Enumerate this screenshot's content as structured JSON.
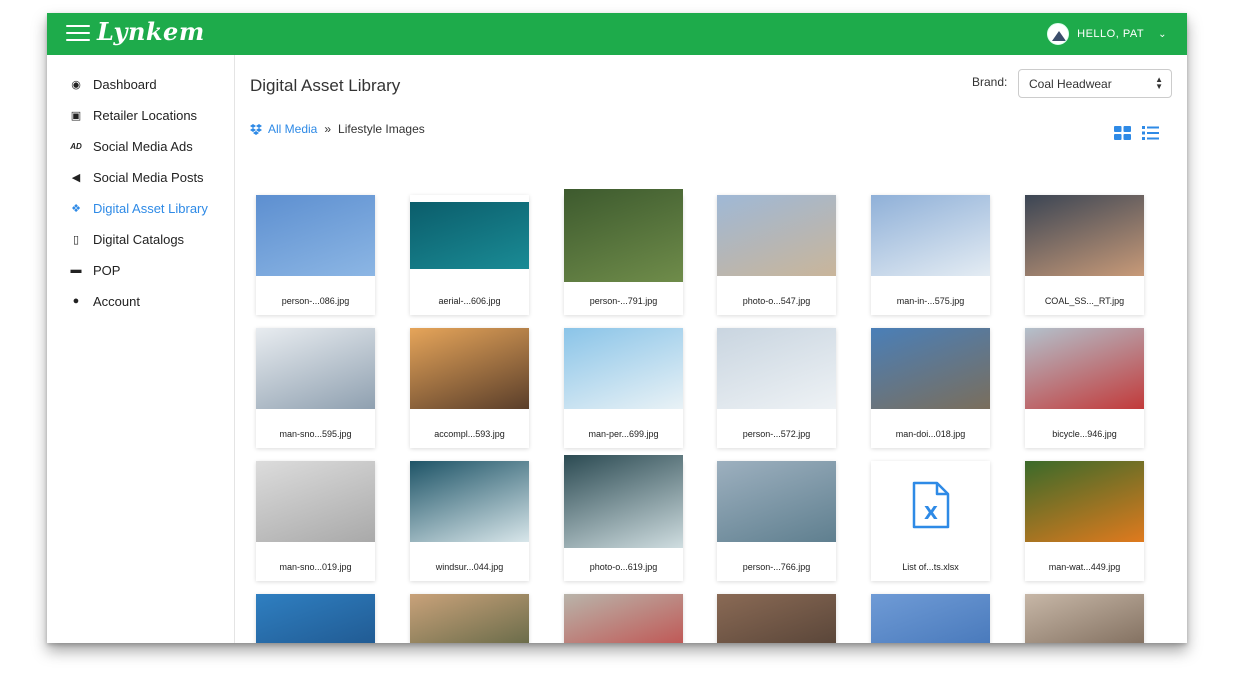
{
  "app": {
    "logo": "Lynkem"
  },
  "header": {
    "greeting": "HELLO, PAT"
  },
  "sidebar": {
    "items": [
      {
        "label": "Dashboard",
        "icon": "dashboard-icon",
        "glyph": "◉"
      },
      {
        "label": "Retailer Locations",
        "icon": "image-icon",
        "glyph": "▣"
      },
      {
        "label": "Social Media Ads",
        "icon": "ads-icon",
        "glyph": "AD"
      },
      {
        "label": "Social Media Posts",
        "icon": "bullhorn-icon",
        "glyph": "◀"
      },
      {
        "label": "Digital Asset Library",
        "icon": "dropbox-icon",
        "glyph": "❖",
        "active": true
      },
      {
        "label": "Digital Catalogs",
        "icon": "pdf-file-icon",
        "glyph": "▯"
      },
      {
        "label": "POP",
        "icon": "cart-icon",
        "glyph": "▬"
      },
      {
        "label": "Account",
        "icon": "user-icon",
        "glyph": "●"
      }
    ]
  },
  "main": {
    "title": "Digital Asset Library",
    "brand_label": "Brand:",
    "brand_value": "Coal Headwear",
    "breadcrumb": {
      "root": "All Media",
      "sep": "»",
      "current": "Lifestyle Images"
    }
  },
  "colors": {
    "header_green": "#1eab4b",
    "accent_blue": "#2e8ae6"
  },
  "assets": [
    {
      "name": "person-...086.jpg",
      "kind": "image",
      "colors": [
        "#5d8fd0",
        "#8cb6e4"
      ]
    },
    {
      "name": "aerial-...606.jpg",
      "kind": "image",
      "colors": [
        "#0b5d6b",
        "#1a8b95"
      ]
    },
    {
      "name": "person-...791.jpg",
      "kind": "image",
      "colors": [
        "#3d5a2e",
        "#6f8c4a"
      ]
    },
    {
      "name": "photo-o...547.jpg",
      "kind": "image",
      "colors": [
        "#9fb8d6",
        "#c9b59a"
      ]
    },
    {
      "name": "man-in-...575.jpg",
      "kind": "image",
      "colors": [
        "#8fb0d8",
        "#e4ecf3"
      ]
    },
    {
      "name": "COAL_SS..._RT.jpg",
      "kind": "image",
      "colors": [
        "#3b4554",
        "#c89a78"
      ]
    },
    {
      "name": "man-sno...595.jpg",
      "kind": "image",
      "colors": [
        "#e8ecf0",
        "#8fa0b0"
      ]
    },
    {
      "name": "accompl...593.jpg",
      "kind": "image",
      "colors": [
        "#e6a55a",
        "#5a3e2a"
      ]
    },
    {
      "name": "man-per...699.jpg",
      "kind": "image",
      "colors": [
        "#8ac4e8",
        "#e9f2f6"
      ]
    },
    {
      "name": "person-...572.jpg",
      "kind": "image",
      "colors": [
        "#c9d5e0",
        "#eef2f5"
      ]
    },
    {
      "name": "man-doi...018.jpg",
      "kind": "image",
      "colors": [
        "#4a7fb8",
        "#7a6e5c"
      ]
    },
    {
      "name": "bicycle...946.jpg",
      "kind": "image",
      "colors": [
        "#b3c1cc",
        "#c23a3a"
      ]
    },
    {
      "name": "man-sno...019.jpg",
      "kind": "image",
      "colors": [
        "#dcdcdc",
        "#a9a9a9"
      ]
    },
    {
      "name": "windsur...044.jpg",
      "kind": "image",
      "colors": [
        "#1e5467",
        "#d8e6ea"
      ]
    },
    {
      "name": "photo-o...619.jpg",
      "kind": "image",
      "colors": [
        "#2b4a52",
        "#cfdde0"
      ]
    },
    {
      "name": "person-...766.jpg",
      "kind": "image",
      "colors": [
        "#9db0bf",
        "#5f7f8f"
      ]
    },
    {
      "name": "List of...ts.xlsx",
      "kind": "file",
      "colors": [
        "#ffffff",
        "#ffffff"
      ]
    },
    {
      "name": "man-wat...449.jpg",
      "kind": "image",
      "colors": [
        "#3a6a2a",
        "#e07a1e"
      ]
    },
    {
      "name": "",
      "kind": "image",
      "colors": [
        "#2f7fc1",
        "#1c4f84"
      ]
    },
    {
      "name": "",
      "kind": "image",
      "colors": [
        "#c9a27a",
        "#4b5a3a"
      ]
    },
    {
      "name": "",
      "kind": "image",
      "colors": [
        "#b9b4aa",
        "#c23a3a"
      ]
    },
    {
      "name": "",
      "kind": "image",
      "colors": [
        "#8a6a55",
        "#4a3a30"
      ]
    },
    {
      "name": "",
      "kind": "image",
      "colors": [
        "#6f9bd6",
        "#3d6fb3"
      ]
    },
    {
      "name": "",
      "kind": "image",
      "colors": [
        "#c7b7a7",
        "#6d5a4a"
      ]
    }
  ]
}
